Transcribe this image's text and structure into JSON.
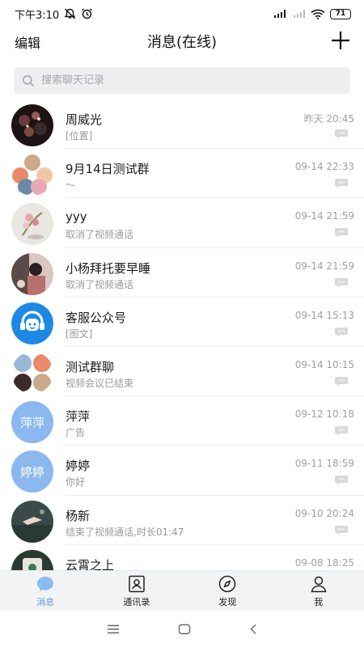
{
  "status_bar": {
    "time": "下午3:10",
    "battery": "71"
  },
  "header": {
    "edit_label": "编辑",
    "title": "消息(在线)"
  },
  "search": {
    "placeholder": "搜索聊天记录"
  },
  "conversations": [
    {
      "name": "周威光",
      "preview": "[位置]",
      "time": "昨天 20:45"
    },
    {
      "name": "9月14日测试群",
      "preview": "～",
      "time": "09-14 22:33"
    },
    {
      "name": "yyy",
      "preview": "取消了视频通话",
      "time": "09-14 21:59"
    },
    {
      "name": "小杨拜托要早睡",
      "preview": "取消了视频通话",
      "time": "09-14 21:59"
    },
    {
      "name": "客服公众号",
      "preview": "[图文]",
      "time": "09-14 15:13"
    },
    {
      "name": "测试群聊",
      "preview": "视频会议已结束",
      "time": "09-14 10:15"
    },
    {
      "name": "萍萍",
      "avatar_text": "萍萍",
      "preview": "广告",
      "time": "09-12 10:18"
    },
    {
      "name": "婷婷",
      "avatar_text": "婷婷",
      "preview": "你好",
      "time": "09-11 18:59"
    },
    {
      "name": "杨新",
      "preview": "结束了视频通话,时长01:47",
      "time": "09-10 20:24"
    },
    {
      "name": "云霄之上",
      "preview": "",
      "time": "09-08 18:25"
    }
  ],
  "tabs": [
    {
      "label": "消息",
      "icon": "chat-bubble-icon",
      "active": true
    },
    {
      "label": "通讯录",
      "icon": "contacts-icon",
      "active": false
    },
    {
      "label": "发现",
      "icon": "compass-icon",
      "active": false
    },
    {
      "label": "我",
      "icon": "person-icon",
      "active": false
    }
  ],
  "colors": {
    "accent": "#5a9be8",
    "text_avatar_bg": "#8bb8ef",
    "service_avatar_bg": "#1e88e5"
  }
}
